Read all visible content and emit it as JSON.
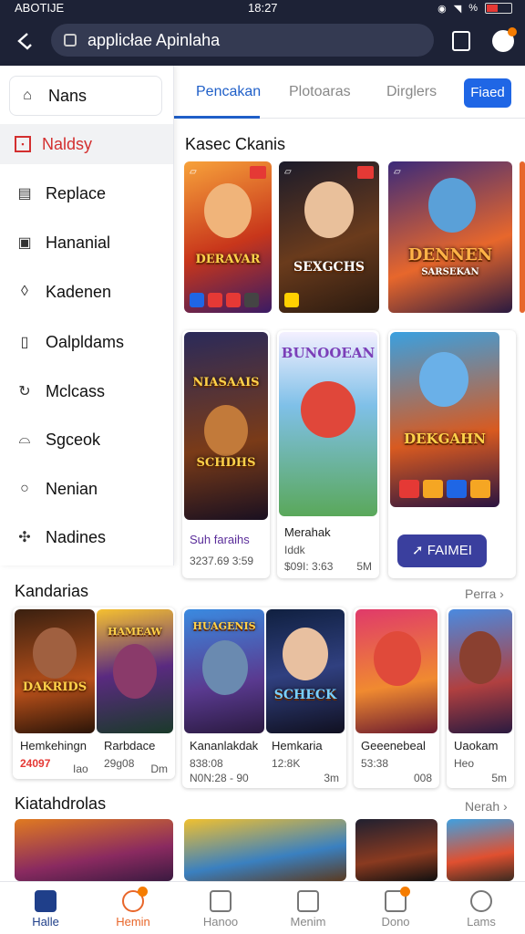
{
  "status_bar": {
    "carrier": "ABOTIJE",
    "time": "18:27",
    "signal_text": "%"
  },
  "browser": {
    "url": "applicłae Apinlaha",
    "tab_count": ""
  },
  "sidebar": {
    "items": [
      {
        "label": "Nans",
        "icon": "home-icon"
      },
      {
        "label": "Naldsy",
        "icon": "square-icon"
      },
      {
        "label": "Replace",
        "icon": "document-icon"
      },
      {
        "label": "Hananial",
        "icon": "frame-icon"
      },
      {
        "label": "Kadenen",
        "icon": "shield-icon"
      },
      {
        "label": "Oalpldams",
        "icon": "tablet-icon"
      },
      {
        "label": "Mclcass",
        "icon": "refresh-icon"
      },
      {
        "label": "Sgceok",
        "icon": "bag-icon"
      },
      {
        "label": "Nenian",
        "icon": "search-icon"
      },
      {
        "label": "Nadines",
        "icon": "puzzle-icon"
      }
    ]
  },
  "tabs": {
    "items": [
      "Pencakan",
      "Plotoaras",
      "Dirglers"
    ],
    "button": "Fiaed"
  },
  "sections": {
    "featured": {
      "title": "Kasec Ckanis"
    },
    "row1": [
      {
        "art_title": "DERAVAR",
        "subtitle": ""
      },
      {
        "art_title": "SEXGCHS",
        "subtitle": ""
      },
      {
        "art_title": "DENNEN",
        "subtitle": "SARSEKAN"
      }
    ],
    "row2": [
      {
        "art_title": "NIASAAIS",
        "art_title2": "SCHDHS",
        "name": "Suh faraihs",
        "meta": "3237.69 3:59"
      },
      {
        "art_title": "BUNOOEAN",
        "name": "Merahak",
        "meta": "Iddk",
        "meta2": "$09I: 3:63",
        "meta3": "5M"
      },
      {
        "art_title": "DEKGAHN",
        "button": "FAIMEI"
      }
    ],
    "kandarias": {
      "title": "Kandarias",
      "more": "Perra ›",
      "cards": [
        {
          "art_title": "DAKRIDS",
          "name": "Hemkehingn",
          "price": "24097",
          "extra": "Iao"
        },
        {
          "art_title": "HAMEAW",
          "name": "Rarbdace",
          "price": "29g08",
          "extra": "Dm"
        },
        {
          "art_title": "HUAGENIS",
          "name": "Kananlakdak",
          "price": "838:08",
          "extra2": "N0N:28 - 90",
          "extra": ""
        },
        {
          "art_title": "SCHECK",
          "name": "Hemkaria",
          "price": "12:8K",
          "extra": "3m"
        },
        {
          "art_title": "",
          "name": "Geeenebeal",
          "price": "53:38",
          "extra": "008",
          "extra2": ""
        },
        {
          "art_title": "",
          "name": "Uaokam",
          "price": "Heo",
          "extra": "5m"
        }
      ]
    },
    "kiatahdrolas": {
      "title": "Kiatahdrolas",
      "more": "Nerah ›"
    }
  },
  "bottom_nav": [
    {
      "label": "Halle",
      "icon": "home-icon"
    },
    {
      "label": "Hemin",
      "icon": "chat-icon"
    },
    {
      "label": "Hanoo",
      "icon": "gamepad-icon"
    },
    {
      "label": "Menim",
      "icon": "store-icon"
    },
    {
      "label": "Dono",
      "icon": "map-icon"
    },
    {
      "label": "Lams",
      "icon": "user-icon"
    }
  ],
  "colors": {
    "header_bg": "#1d2236",
    "accent": "#1f66e5",
    "active_nav": "#1f3f8a",
    "danger": "#d32f2f"
  }
}
